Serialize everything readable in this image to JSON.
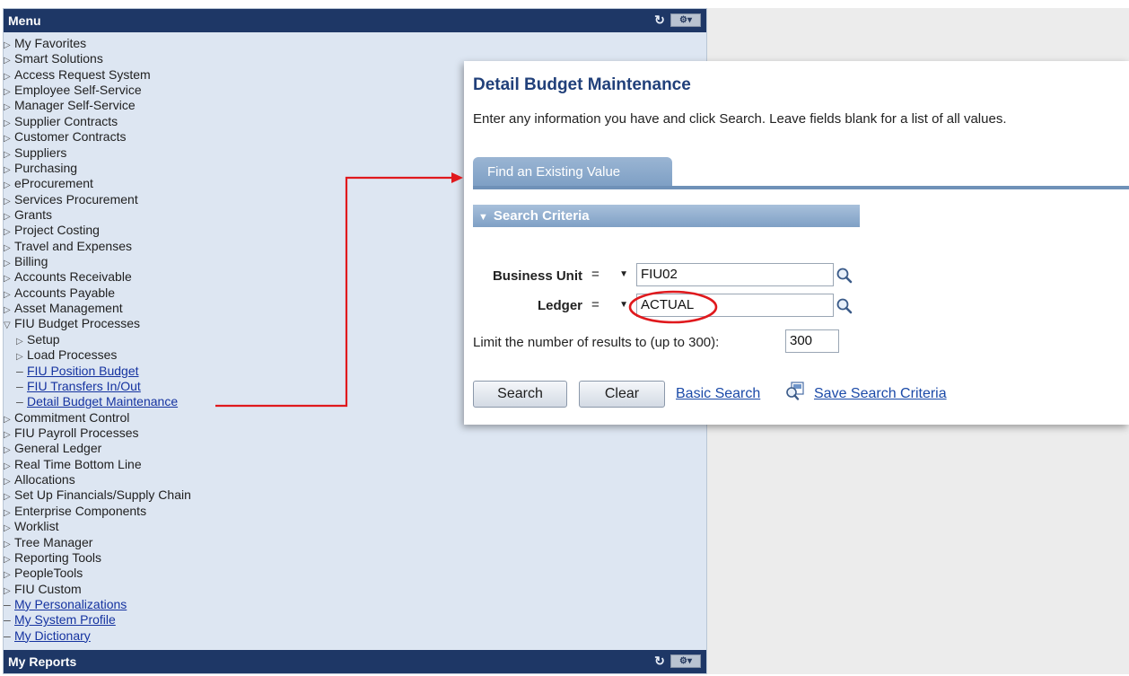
{
  "menu": {
    "title": "Menu",
    "items": [
      {
        "label": "My Favorites",
        "kind": "folder"
      },
      {
        "label": "Smart Solutions",
        "kind": "folder"
      },
      {
        "label": "Access Request System",
        "kind": "folder"
      },
      {
        "label": "Employee Self-Service",
        "kind": "folder"
      },
      {
        "label": "Manager Self-Service",
        "kind": "folder"
      },
      {
        "label": "Supplier Contracts",
        "kind": "folder"
      },
      {
        "label": "Customer Contracts",
        "kind": "folder"
      },
      {
        "label": "Suppliers",
        "kind": "folder"
      },
      {
        "label": "Purchasing",
        "kind": "folder"
      },
      {
        "label": "eProcurement",
        "kind": "folder"
      },
      {
        "label": "Services Procurement",
        "kind": "folder"
      },
      {
        "label": "Grants",
        "kind": "folder"
      },
      {
        "label": "Project Costing",
        "kind": "folder"
      },
      {
        "label": "Travel and Expenses",
        "kind": "folder"
      },
      {
        "label": "Billing",
        "kind": "folder"
      },
      {
        "label": "Accounts Receivable",
        "kind": "folder"
      },
      {
        "label": "Accounts Payable",
        "kind": "folder"
      },
      {
        "label": "Asset Management",
        "kind": "folder"
      },
      {
        "label": "FIU Budget Processes",
        "kind": "open-folder"
      },
      {
        "label": "Setup",
        "kind": "sub-folder"
      },
      {
        "label": "Load Processes",
        "kind": "sub-folder"
      },
      {
        "label": "FIU Position Budget",
        "kind": "sub-link"
      },
      {
        "label": "FIU Transfers In/Out",
        "kind": "sub-link"
      },
      {
        "label": "Detail Budget Maintenance",
        "kind": "sub-link"
      },
      {
        "label": "Commitment Control",
        "kind": "folder"
      },
      {
        "label": "FIU Payroll Processes",
        "kind": "folder"
      },
      {
        "label": "General Ledger",
        "kind": "folder"
      },
      {
        "label": "Real Time Bottom Line",
        "kind": "folder"
      },
      {
        "label": "Allocations",
        "kind": "folder"
      },
      {
        "label": "Set Up Financials/Supply Chain",
        "kind": "folder"
      },
      {
        "label": "Enterprise Components",
        "kind": "folder"
      },
      {
        "label": "Worklist",
        "kind": "folder"
      },
      {
        "label": "Tree Manager",
        "kind": "folder"
      },
      {
        "label": "Reporting Tools",
        "kind": "folder"
      },
      {
        "label": "PeopleTools",
        "kind": "folder"
      },
      {
        "label": "FIU Custom",
        "kind": "folder"
      },
      {
        "label": "My Personalizations",
        "kind": "link"
      },
      {
        "label": "My System Profile",
        "kind": "link"
      },
      {
        "label": "My Dictionary",
        "kind": "link"
      }
    ]
  },
  "reports": {
    "title": "My Reports"
  },
  "search": {
    "page_title": "Detail Budget Maintenance",
    "instructions": "Enter any information you have and click Search. Leave fields blank for a list of all values.",
    "tab_label": "Find an Existing Value",
    "criteria_label": "Search Criteria",
    "business_unit": {
      "label": "Business Unit",
      "operator": "=",
      "value": "FIU02"
    },
    "ledger": {
      "label": "Ledger",
      "operator": "=",
      "value": "ACTUAL"
    },
    "limit_label": "Limit the number of results to (up to 300):",
    "limit_value": "300",
    "search_button": "Search",
    "clear_button": "Clear",
    "basic_search_link": "Basic Search",
    "save_criteria_link": "Save Search Criteria"
  },
  "annotation_color": "#e0191d",
  "icons": {
    "refresh": "refresh-icon",
    "settings": "gear-dropdown-icon",
    "lookup": "magnifier-icon",
    "save": "save-search-icon"
  }
}
